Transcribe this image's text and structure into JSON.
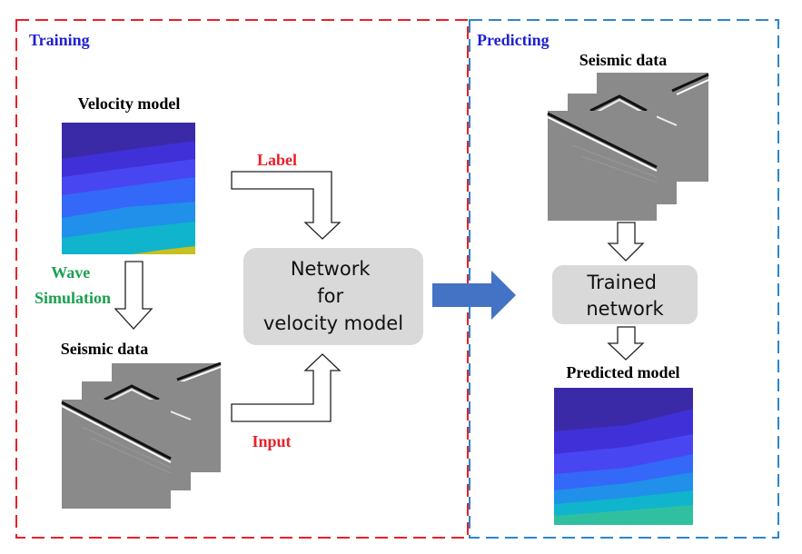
{
  "training": {
    "title": "Training",
    "velocity_model_label": "Velocity model",
    "wave_simulation_label_line1": "Wave",
    "wave_simulation_label_line2": "Simulation",
    "seismic_data_label": "Seismic data",
    "label_arrow_text": "Label",
    "input_arrow_text": "Input",
    "network_line1": "Network",
    "network_line2": "for",
    "network_line3": "velocity model"
  },
  "predicting": {
    "title": "Predicting",
    "seismic_data_label": "Seismic data",
    "trained_network_line1": "Trained",
    "trained_network_line2": "network",
    "predicted_model_label": "Predicted model"
  },
  "colors": {
    "training_border": "#e8202a",
    "predicting_border": "#2e86c8",
    "training_title": "#1f1fd0",
    "label_input_text": "#e8202a",
    "wave_simulation_text": "#1aa050",
    "flow_arrow": "#4472c4",
    "network_box": "#d9d9d9"
  }
}
